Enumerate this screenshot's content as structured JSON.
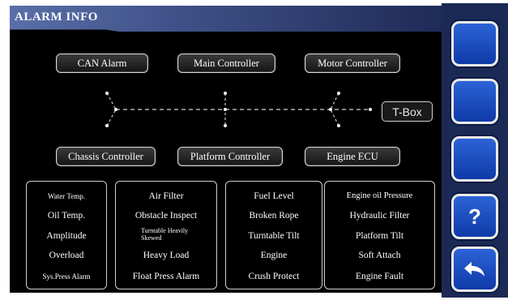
{
  "title": "ALARM INFO",
  "controllers": {
    "can_alarm": "CAN Alarm",
    "main_controller": "Main Controller",
    "motor_controller": "Motor Controller",
    "chassis_controller": "Chassis Controller",
    "platform_controller": "Platform Controller",
    "engine_ecu": "Engine ECU",
    "tbox": "T-Box"
  },
  "alarms": {
    "col1": [
      "Water Temp.",
      "Oil Temp.",
      "Amplitude",
      "Overload",
      "Sys.Press Alarm"
    ],
    "col2": [
      "Air Filter",
      "Obstacle Inspect",
      "Turntable Heavily Skewed",
      "Heavy Load",
      "Float Press Alarm"
    ],
    "col3": [
      "Fuel Level",
      "Broken Rope",
      "Turntable Tilt",
      "Engine",
      "Crush Protect"
    ],
    "col4": [
      "Engine oil Pressure",
      "Hydraulic Filter",
      "Platform Tilt",
      "Soft Attach",
      "Engine Fault"
    ]
  },
  "sidebar": {
    "help_label": "?",
    "icons": [
      "blank-button",
      "blank-button",
      "blank-button",
      "help-icon",
      "back-arrow-icon"
    ]
  },
  "colors": {
    "sidebar": "#1b2a55",
    "button_blue": "#1f52c8",
    "title_gradient": "#4a5f9c"
  }
}
